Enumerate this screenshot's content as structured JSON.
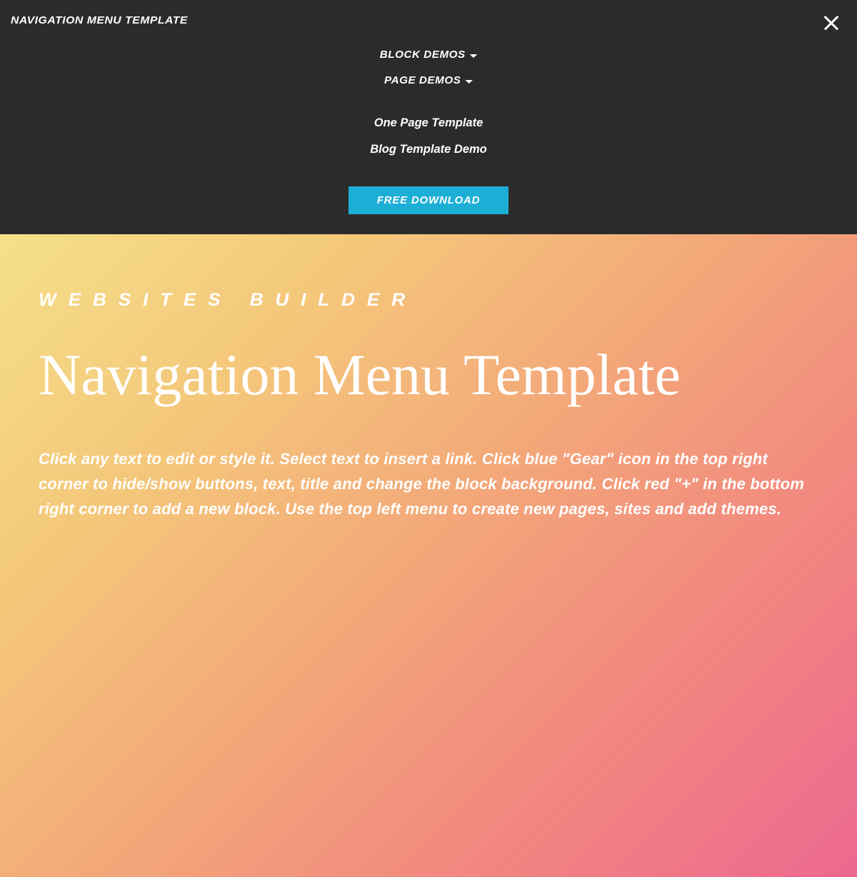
{
  "header": {
    "logo": "NAVIGATION MENU TEMPLATE",
    "nav": {
      "dropdowns": [
        {
          "label": "BLOCK DEMOS"
        },
        {
          "label": "PAGE DEMOS"
        }
      ],
      "links": [
        {
          "label": "One Page Template"
        },
        {
          "label": "Blog Template Demo"
        }
      ],
      "download_button": "FREE DOWNLOAD"
    }
  },
  "hero": {
    "subtitle": "WEBSITES BUILDER",
    "title": "Navigation Menu Template",
    "description": "Click any text to edit or style it. Select text to insert a link. Click blue \"Gear\" icon in the top right corner to hide/show buttons, text, title and change the block background. Click red \"+\" in the bottom right corner to add a new block. Use the top left menu to create new pages, sites and add themes."
  }
}
